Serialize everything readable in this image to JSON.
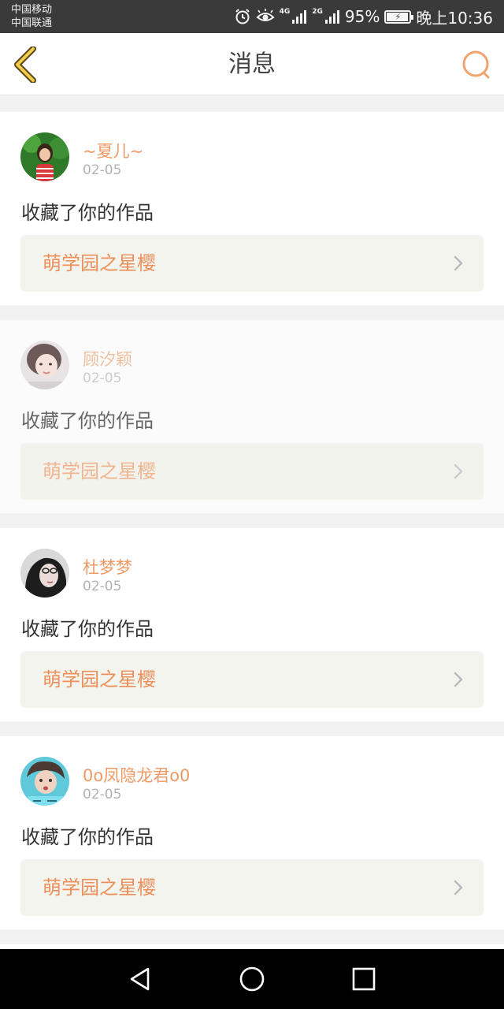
{
  "status_bar": {
    "carrier_1": "中国移动",
    "carrier_2": "中国联通",
    "icons": [
      "alarm-icon",
      "eye-icon",
      "signal-4g-icon",
      "signal-2g-icon",
      "battery-icon"
    ],
    "net_1": "4G",
    "net_2": "2G",
    "battery": "95%",
    "battery_level": 0.95,
    "time": "晚上10:36"
  },
  "header": {
    "title": "消息",
    "accent_color": "#ee9a66",
    "icons": [
      "back-chevron-icon",
      "chat-bubble-icon"
    ]
  },
  "messages": [
    {
      "username": "~夏儿~",
      "date": "02-05",
      "action": "收藏了你的作品",
      "work_title": "萌学园之星樱",
      "faded": false,
      "avatar": "avatar-photo-1"
    },
    {
      "username": "顾汐颖",
      "date": "02-05",
      "action": "收藏了你的作品",
      "work_title": "萌学园之星樱",
      "faded": true,
      "avatar": "avatar-photo-2"
    },
    {
      "username": "杜梦梦",
      "date": "02-05",
      "action": "收藏了你的作品",
      "work_title": "萌学园之星樱",
      "faded": false,
      "avatar": "avatar-photo-3"
    },
    {
      "username": "0o凤隐龙君o0",
      "date": "02-05",
      "action": "收藏了你的作品",
      "work_title": "萌学园之星樱",
      "faded": false,
      "avatar": "avatar-photo-4"
    }
  ],
  "nav_bar": {
    "icons": [
      "back-triangle-icon",
      "home-circle-icon",
      "recents-square-icon"
    ]
  }
}
